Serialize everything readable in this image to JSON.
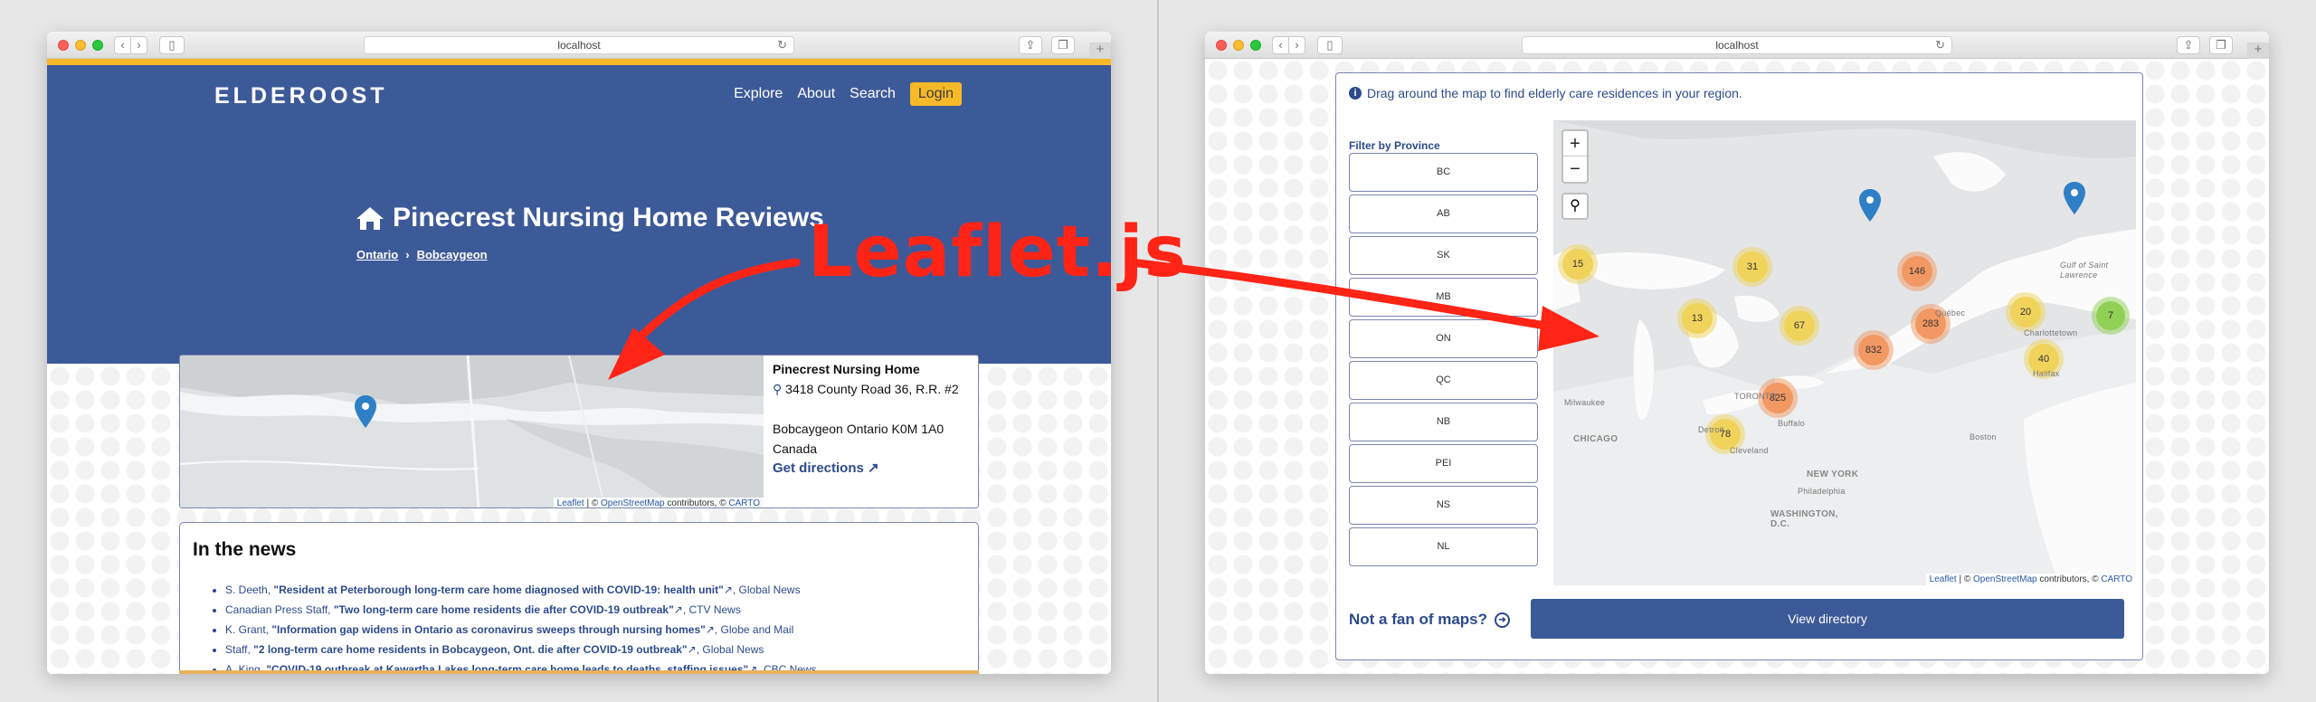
{
  "left_window": {
    "url": "localhost",
    "brand": "ELDEROOST",
    "nav": [
      "Explore",
      "About",
      "Search"
    ],
    "login": "Login",
    "page_title": "Pinecrest Nursing Home Reviews",
    "breadcrumbs": [
      "Ontario",
      "Bobcaygeon"
    ],
    "breadcrumb_sep": "›",
    "facility": {
      "name": "Pinecrest Nursing Home",
      "street": "3418 County Road 36, R.R. #2",
      "city_line": "Bobcaygeon Ontario K0M 1A0",
      "country": "Canada",
      "directions": "Get directions"
    },
    "map_attribution": {
      "leaflet": "Leaflet",
      "sep": " | © ",
      "osm": "OpenStreetMap",
      "contrib": " contributors, © ",
      "carto": "CARTO"
    },
    "news": {
      "heading": "In the news",
      "items": [
        {
          "author": "S. Deeth, ",
          "title": "\"Resident at Peterborough long-term care home diagnosed with COVID-19: health unit\"",
          "source": ", Global News"
        },
        {
          "author": "Canadian Press Staff, ",
          "title": "\"Two long-term care home residents die after COVID-19 outbreak\"",
          "source": ", CTV News"
        },
        {
          "author": "K. Grant, ",
          "title": "\"Information gap widens in Ontario as coronavirus sweeps through nursing homes\"",
          "source": ", Globe and Mail"
        },
        {
          "author": "Staff, ",
          "title": "\"2 long-term care home residents in Bobcaygeon, Ont. die after COVID-19 outbreak\"",
          "source": ", Global News"
        },
        {
          "author": "A. King, ",
          "title": "\"COVID-19 outbreak at Kawartha Lakes long-term care home leads to deaths, staffing issues\"",
          "source": ", CBC News"
        }
      ]
    }
  },
  "annotation": "Leaflet.js",
  "right_window": {
    "url": "localhost",
    "tip": "Drag around the map to find elderly care residences in your region.",
    "filter_label": "Filter by Province",
    "provinces": [
      "BC",
      "AB",
      "SK",
      "MB",
      "ON",
      "QC",
      "NB",
      "PEI",
      "NS",
      "NL"
    ],
    "zoom_in": "+",
    "zoom_out": "−",
    "clusters": [
      "15",
      "31",
      "146",
      "13",
      "67",
      "283",
      "20",
      "7",
      "832",
      "40",
      "825",
      "78"
    ],
    "place_labels": [
      "Milwaukee",
      "CHICAGO",
      "Detroit",
      "Cleveland",
      "TORONTO",
      "Buffalo",
      "Québec",
      "Charlottetown",
      "Gulf of Saint Lawrence",
      "Boston",
      "NEW YORK",
      "Philadelphia",
      "WASHINGTON, D.C.",
      "Halifax"
    ],
    "map_attribution": {
      "leaflet": "Leaflet",
      "sep": " | © ",
      "osm": "OpenStreetMap",
      "contrib": " contributors, © ",
      "carto": "CARTO"
    },
    "not_fan": "Not a fan of maps?",
    "view_directory": "View directory"
  },
  "colors": {
    "brand_blue": "#3d5a98",
    "accent_yellow": "#f7b928",
    "link_blue": "#2c4a8c",
    "annotation_red": "#ff2416",
    "cluster_small": "#f0d35b",
    "cluster_medium": "#f29862",
    "cluster_green": "#8fd055"
  }
}
